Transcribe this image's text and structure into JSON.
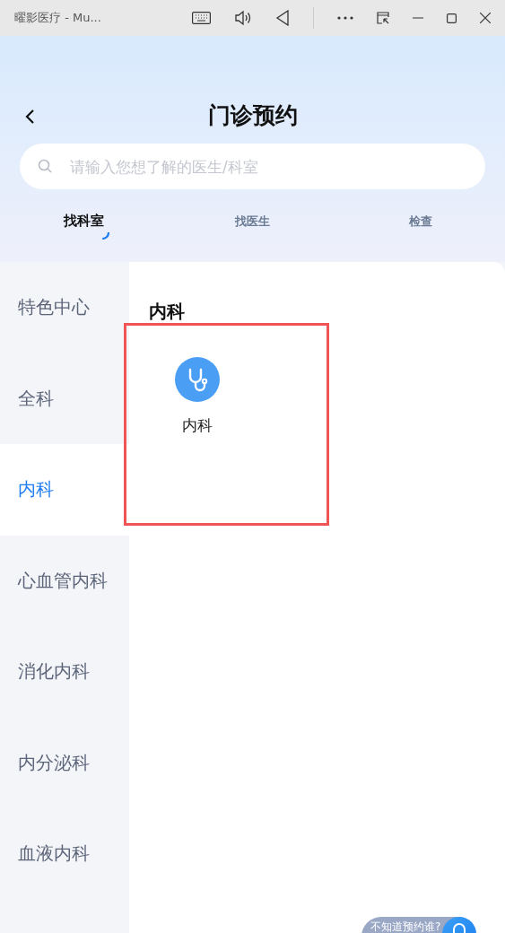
{
  "window": {
    "title": "曜影医疗 - Mu..."
  },
  "header": {
    "title": "门诊预约"
  },
  "search": {
    "placeholder": "请输入您想了解的医生/科室"
  },
  "tabs": [
    {
      "label": "找科室",
      "selected": true
    },
    {
      "label": "找医生",
      "selected": false
    },
    {
      "label": "检查",
      "selected": false
    }
  ],
  "sidebar": {
    "items": [
      {
        "label": "特色中心",
        "selected": false
      },
      {
        "label": "全科",
        "selected": false
      },
      {
        "label": "内科",
        "selected": true
      },
      {
        "label": "心血管内科",
        "selected": false
      },
      {
        "label": "消化内科",
        "selected": false
      },
      {
        "label": "内分泌科",
        "selected": false
      },
      {
        "label": "血液内科",
        "selected": false
      }
    ]
  },
  "content": {
    "heading": "内科",
    "departments": [
      {
        "label": "内科",
        "highlighted": true
      }
    ]
  },
  "floating_help": {
    "label": "不知道预约谁?"
  }
}
